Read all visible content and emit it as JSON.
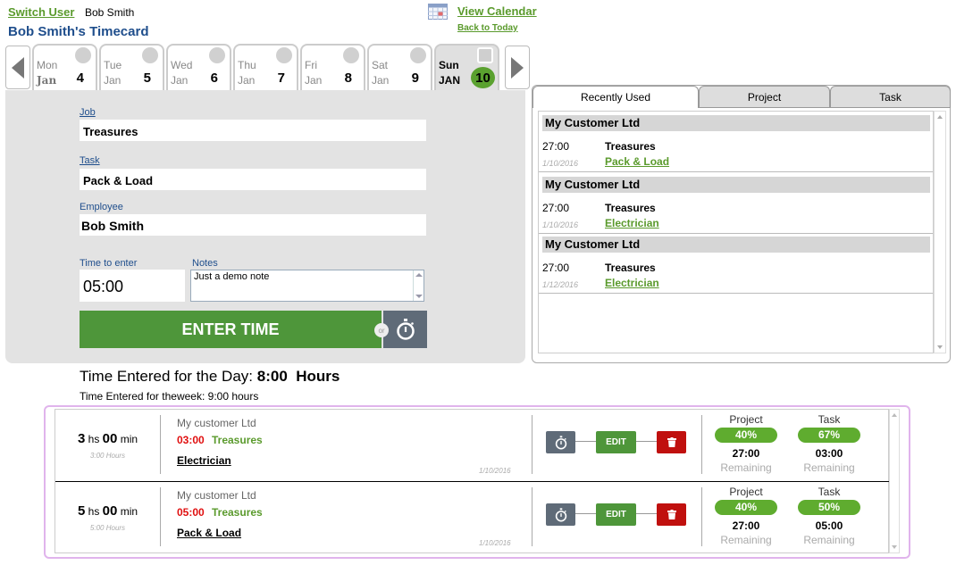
{
  "header": {
    "switch_user": "Switch User",
    "current_user": "Bob Smith",
    "title": "Bob Smith's Timecard",
    "view_calendar": "View Calendar",
    "back_to_today": "Back to Today"
  },
  "days": [
    {
      "name": "Mon",
      "month": "Jan",
      "num": "4",
      "active": false
    },
    {
      "name": "Tue",
      "month": "Jan",
      "num": "5",
      "active": false
    },
    {
      "name": "Wed",
      "month": "Jan",
      "num": "6",
      "active": false
    },
    {
      "name": "Thu",
      "month": "Jan",
      "num": "7",
      "active": false
    },
    {
      "name": "Fri",
      "month": "Jan",
      "num": "8",
      "active": false
    },
    {
      "name": "Sat",
      "month": "Jan",
      "num": "9",
      "active": false
    },
    {
      "name": "Sun",
      "month": "JAN",
      "num": "10",
      "active": true
    }
  ],
  "form": {
    "job_label": "Job",
    "job_value": "Treasures",
    "task_label": "Task",
    "task_value": "Pack & Load",
    "employee_label": "Employee",
    "employee_value": "Bob Smith",
    "time_label": "Time to enter",
    "time_value": "05:00",
    "notes_label": "Notes",
    "notes_value": "Just a demo note",
    "enter_button": "ENTER TIME",
    "or_label": "or"
  },
  "right_panel": {
    "tabs": [
      "Recently Used",
      "Project",
      "Task"
    ],
    "active_tab": "Recently Used",
    "items": [
      {
        "customer": "My Customer Ltd",
        "hours": "27:00",
        "date": "1/10/2016",
        "job": "Treasures",
        "task": "Pack & Load"
      },
      {
        "customer": "My Customer Ltd",
        "hours": "27:00",
        "date": "1/10/2016",
        "job": "Treasures",
        "task": "Electrician"
      },
      {
        "customer": "My Customer Ltd",
        "hours": "27:00",
        "date": "1/12/2016",
        "job": "Treasures",
        "task": "Electrician"
      }
    ]
  },
  "totals": {
    "day_label": "Time Entered for the Day:",
    "day_value": "8:00  Hours",
    "week_label": "Time Entered for theweek:",
    "week_value": "9:00 hours"
  },
  "entries": [
    {
      "hours": "3",
      "hs": "hs",
      "minutes": "00",
      "min": "min",
      "hours_text": "3:00 Hours",
      "customer": "My customer Ltd",
      "time": "03:00",
      "job": "Treasures",
      "task": "Electrician",
      "date": "1/10/2016",
      "edit": "EDIT",
      "project_label": "Project",
      "project_pct": "40%",
      "project_remaining": "27:00",
      "task_label": "Task",
      "task_pct": "67%",
      "task_remaining": "03:00",
      "remaining_label": "Remaining"
    },
    {
      "hours": "5",
      "hs": "hs",
      "minutes": "00",
      "min": "min",
      "hours_text": "5:00 Hours",
      "customer": "My customer Ltd",
      "time": "05:00",
      "job": "Treasures",
      "task": "Pack & Load",
      "date": "1/10/2016",
      "edit": "EDIT",
      "project_label": "Project",
      "project_pct": "40%",
      "project_remaining": "27:00",
      "task_label": "Task",
      "task_pct": "50%",
      "task_remaining": "05:00",
      "remaining_label": "Remaining"
    }
  ],
  "colors": {
    "brand_green": "#4e963a",
    "link_green": "#5a9a2c",
    "title_blue": "#1f4e8c",
    "alert_red": "#e01010",
    "delete_red": "#c0100e",
    "timer_slate": "#5f6b78"
  }
}
